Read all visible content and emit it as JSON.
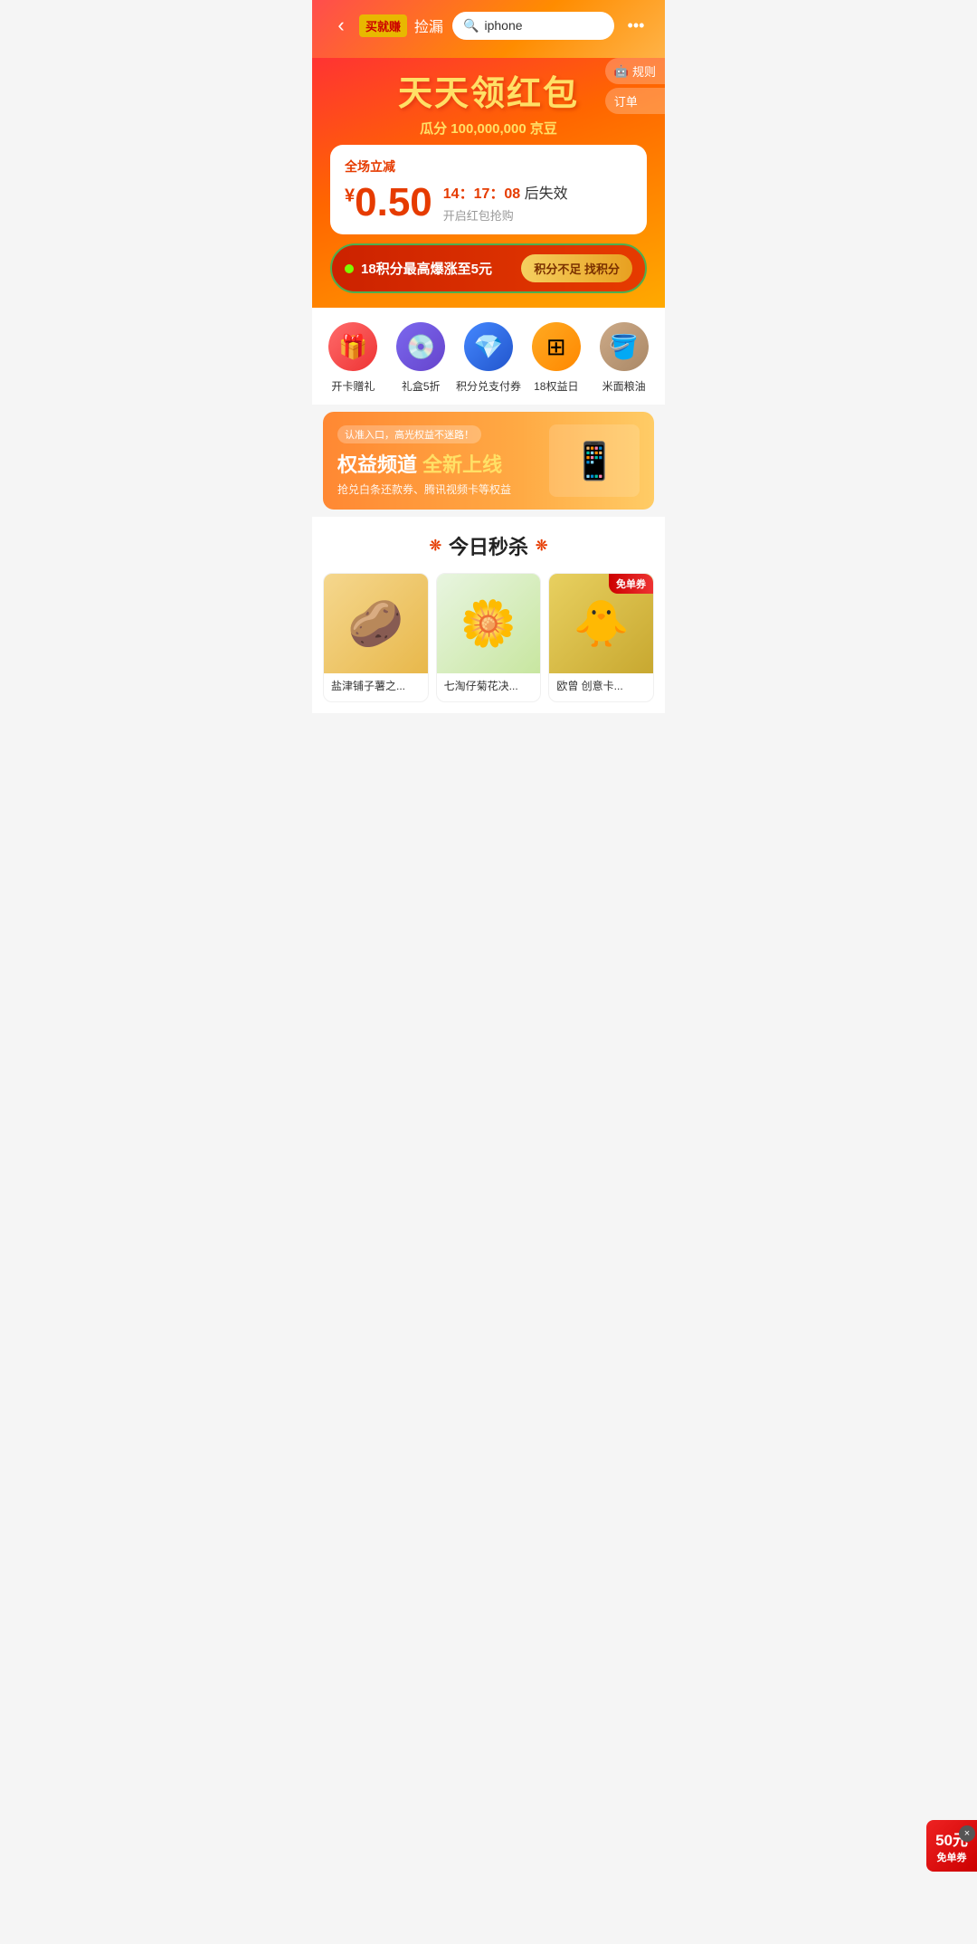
{
  "header": {
    "back_icon": "‹",
    "more_icon": "•••",
    "nav_logo": "买就赚",
    "nav_text": "捡漏",
    "search_placeholder": "iphone",
    "search_icon": "🔍"
  },
  "banner": {
    "title_main": "天天领红包",
    "subtitle_prefix": "瓜分",
    "subtitle_amount": "100,000,000",
    "subtitle_suffix": "京豆",
    "right_btns": [
      {
        "icon": "🤖",
        "label": "规则"
      },
      {
        "label": "订单"
      }
    ]
  },
  "coupon": {
    "label": "全场立减",
    "amount": "0.50",
    "currency": "¥",
    "timer_label": "后失效",
    "timer_value": "14：17：08",
    "desc": "开启红包抢购"
  },
  "points_banner": {
    "text": "18积分最高爆涨至5元",
    "btn_label": "积分不足 找积分"
  },
  "quick_icons": [
    {
      "emoji": "🎁",
      "label": "开卡赠礼",
      "style": "icon-red"
    },
    {
      "emoji": "💿",
      "label": "礼盒5折",
      "style": "icon-purple"
    },
    {
      "emoji": "💠",
      "label": "积分兑支付券",
      "style": "icon-blue"
    },
    {
      "emoji": "🟧",
      "label": "18权益日",
      "style": "icon-orange"
    },
    {
      "emoji": "🪣",
      "label": "米面粮油",
      "style": "icon-tan"
    }
  ],
  "promo_banner": {
    "tag": "认准入口，高光权益不迷路！",
    "title_part1": "权益频道",
    "title_part2": " 全新上线",
    "desc": "抢兑白条还款券、腾讯视频卡等权益",
    "image_emoji": "📱"
  },
  "flash_sale": {
    "title": "今日秒杀",
    "deco_left": "❊",
    "deco_right": "❊",
    "products": [
      {
        "name": "盐津铺子薯之...",
        "emoji": "🥔",
        "bg": "chips"
      },
      {
        "name": "七淘仔菊花决...",
        "emoji": "🌼",
        "bg": "tea"
      },
      {
        "name": "欧曾 创意卡...",
        "emoji": "🐥",
        "bg": "duck"
      }
    ]
  },
  "floating_coupon": {
    "amount": "50元",
    "label": "免单券",
    "close": "×"
  }
}
